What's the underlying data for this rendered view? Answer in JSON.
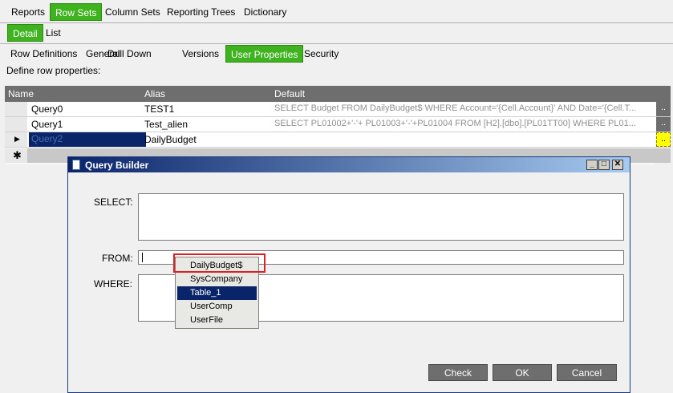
{
  "top_tabs": [
    "Reports",
    "Row Sets",
    "Column Sets",
    "Reporting Trees",
    "Dictionary"
  ],
  "sub_tabs": [
    "Detail",
    "List"
  ],
  "section_tabs": [
    "Row Definitions",
    "General",
    "Drill Down",
    "Versions",
    "User Properties",
    "Security"
  ],
  "description": "Define row properties:",
  "grid": {
    "headers": [
      "Name",
      "Alias",
      "Default"
    ],
    "rows": [
      {
        "name": "Query0",
        "alias": "TEST1",
        "default": "SELECT  Budget FROM DailyBudget$ WHERE Account='{Cell.Account}' AND Date='{Cell.T..."
      },
      {
        "name": "Query1",
        "alias": "Test_alien",
        "default": "SELECT  PL01002+'-'+ PL01003+'-'+PL01004  FROM  [H2].[dbo].[PL01TT00]  WHERE  PL01..."
      },
      {
        "name": "Query2",
        "alias": "DailyBudget",
        "default": ""
      }
    ],
    "ellipsis": "..",
    "new_row_marker": "✱",
    "current_row_marker": "▶"
  },
  "dialog": {
    "title": "Query Builder",
    "select_label": "SELECT:",
    "from_label": "FROM:",
    "where_label": "WHERE:",
    "from_value": "",
    "check_label": "Check",
    "ok_label": "OK",
    "cancel_label": "Cancel",
    "dropdown_items": [
      "DailyBudget$",
      "SysCompany",
      "Table_1",
      "UserComp",
      "UserFile"
    ],
    "dropdown_selected": "Table_1"
  },
  "colors": {
    "tab_active": "#3fb21f",
    "title_bar": "#0a246a",
    "selection": "#0a246a",
    "highlight_box": "#e02020"
  }
}
